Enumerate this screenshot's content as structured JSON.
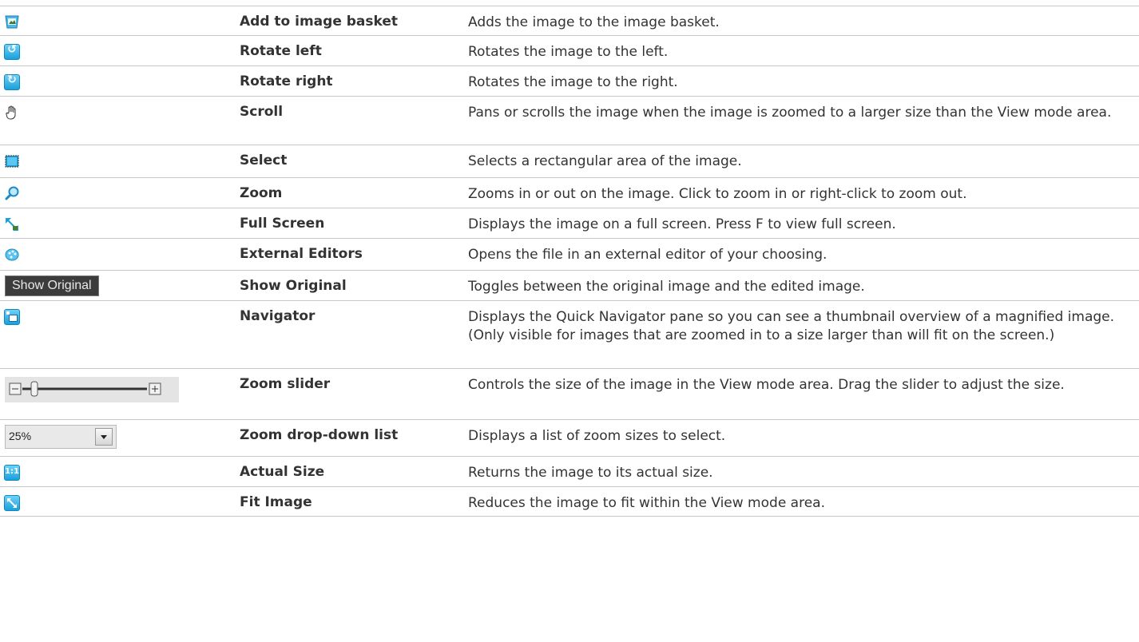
{
  "rows": [
    {
      "icon": "image-basket-icon",
      "name": "Add to image basket",
      "desc": "Adds the image to the image basket."
    },
    {
      "icon": "rotate-left-icon",
      "name": "Rotate left",
      "desc": "Rotates the image to the left."
    },
    {
      "icon": "rotate-right-icon",
      "name": "Rotate right",
      "desc": "Rotates the image to the right."
    },
    {
      "icon": "hand-icon",
      "name": "Scroll",
      "desc": "Pans or scrolls the image when the image is zoomed to a larger size than the View mode area."
    },
    {
      "icon": "select-rectangle-icon",
      "name": "Select",
      "desc": "Selects a rectangular area of the image."
    },
    {
      "icon": "magnifier-icon",
      "name": "Zoom",
      "desc": "Zooms in or out on the image. Click to zoom in or right-click to zoom out."
    },
    {
      "icon": "full-screen-icon",
      "name": "Full Screen",
      "desc": "Displays the image on a full screen. Press F to view full screen."
    },
    {
      "icon": "palette-icon",
      "name": "External Editors",
      "desc": "Opens the file in an external editor of your choosing."
    },
    {
      "icon": "show-original-button",
      "name": "Show Original",
      "desc": "Toggles between the original image and the edited image.",
      "button_label": "Show Original"
    },
    {
      "icon": "navigator-icon",
      "name": "Navigator",
      "desc": "Displays the Quick Navigator pane so you can see a thumbnail overview of a magnified image. (Only visible for images that are zoomed in to a size larger than will fit on the screen.)"
    },
    {
      "icon": "zoom-slider-control",
      "name": "Zoom slider",
      "desc": "Controls the size of the image in the View mode area. Drag the slider to adjust the size."
    },
    {
      "icon": "zoom-dropdown-control",
      "name": "Zoom drop-down list",
      "desc": "Displays a list of zoom sizes to select.",
      "dropdown_value": "25%"
    },
    {
      "icon": "actual-size-icon",
      "name": "Actual Size",
      "desc": "Returns the image to its actual size.",
      "icon_text": "1:1"
    },
    {
      "icon": "fit-image-icon",
      "name": "Fit Image",
      "desc": "Reduces the image to fit within the View mode area."
    }
  ],
  "colors": {
    "accent": "#1aa0dc",
    "text": "#333333",
    "rule": "#c8c8c8"
  }
}
